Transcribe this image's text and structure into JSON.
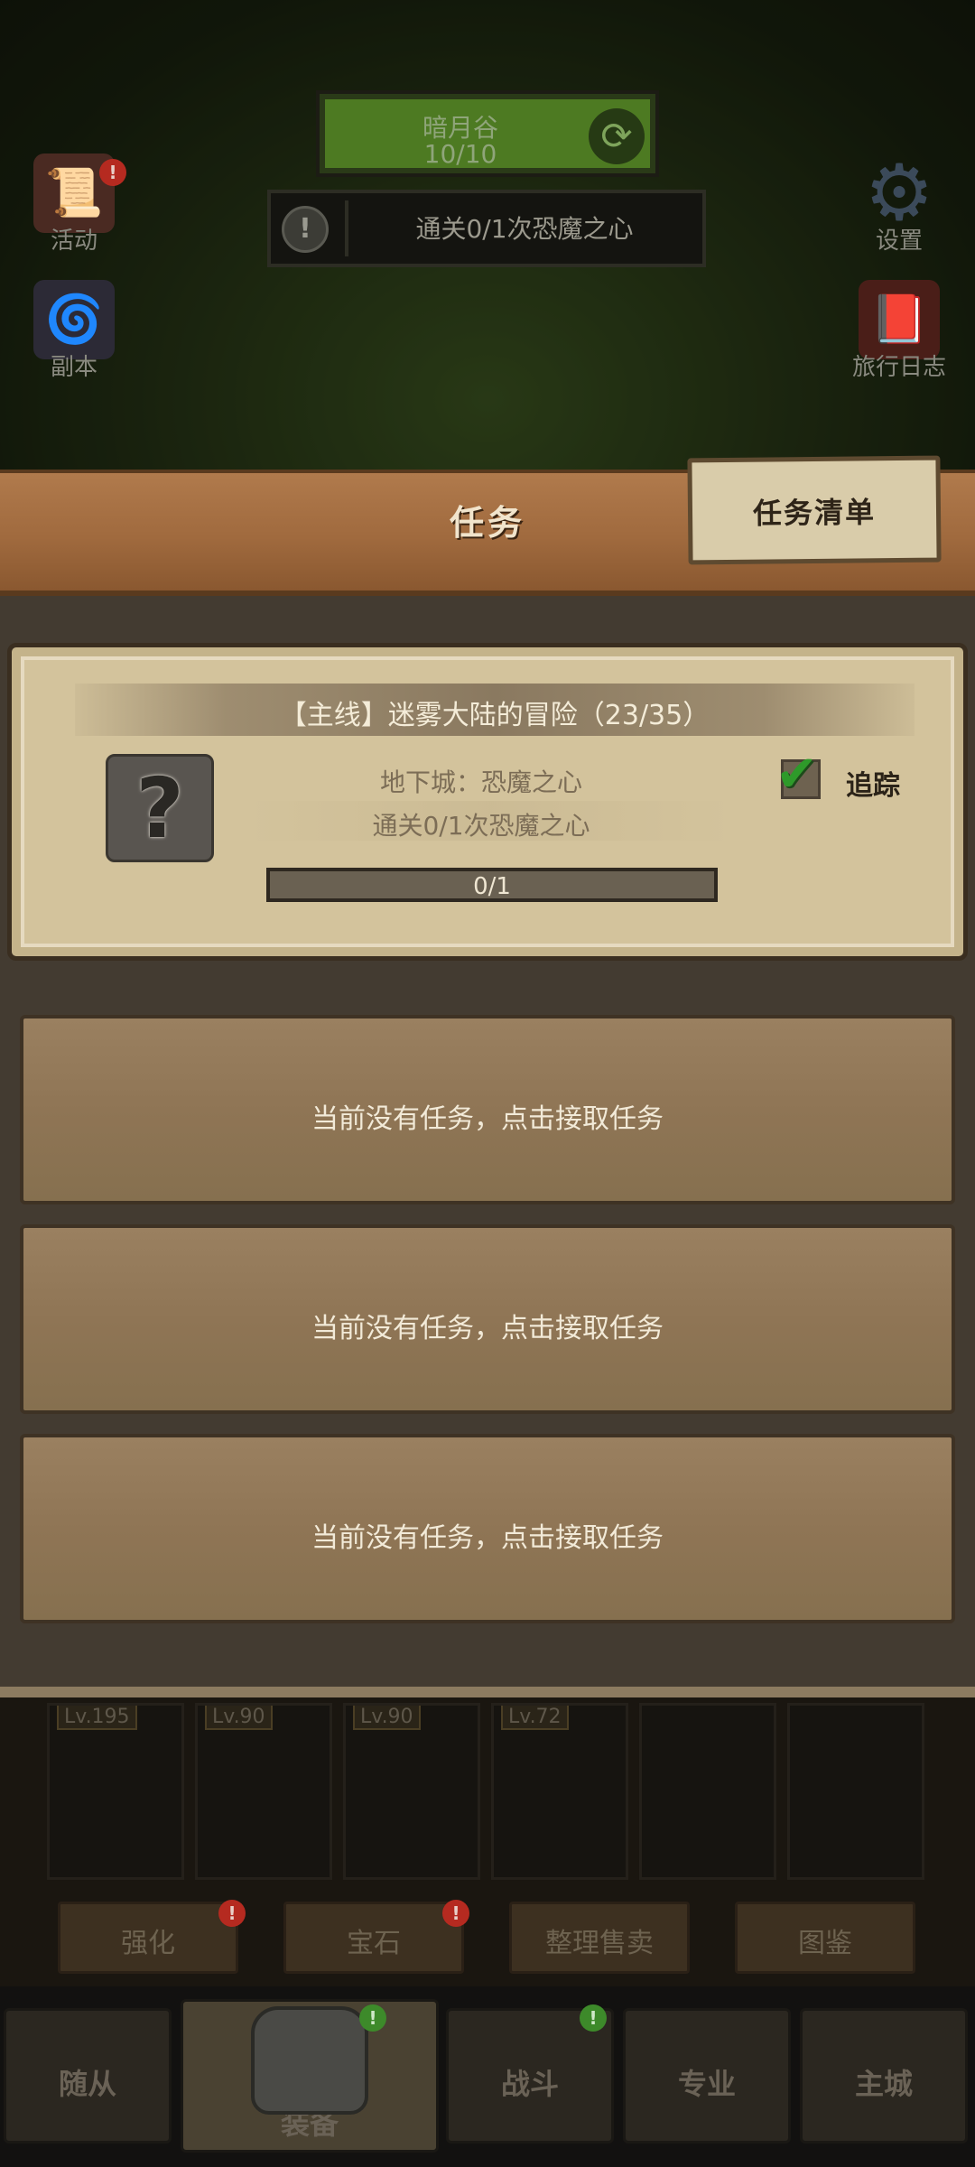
{
  "header": {
    "location_name": "暗月谷",
    "location_count": "10/10",
    "quest_tracker_text": "通关0/1次恐魔之心"
  },
  "side_icons": {
    "activity": "活动",
    "dungeon": "副本",
    "settings": "设置",
    "travel_log": "旅行日志"
  },
  "panel": {
    "title": "任务",
    "list_tab": "任务清单"
  },
  "main_quest": {
    "title": "【主线】迷雾大陆的冒险（23/35）",
    "line1": "地下城：恐魔之心",
    "line2": "通关0/1次恐魔之心",
    "track_label": "追踪",
    "progress_text": "0/1",
    "progress_fraction": 0
  },
  "empty_slots": [
    {
      "text": "当前没有任务，点击接取任务"
    },
    {
      "text": "当前没有任务，点击接取任务"
    },
    {
      "text": "当前没有任务，点击接取任务"
    }
  ],
  "grid_levels": [
    "Lv.195",
    "Lv.90",
    "Lv.90",
    "Lv.72"
  ],
  "sub_buttons": [
    "强化",
    "宝石",
    "整理售卖",
    "图鉴"
  ],
  "nav_tabs": [
    "随从",
    "装备",
    "战斗",
    "专业",
    "主城"
  ],
  "colors": {
    "panel_bg": "#433b31",
    "card_bg": "#d3c39c",
    "header_plank": "#a06a3e",
    "empty_slot": "#8f7555",
    "track_check": "#2e9a2a"
  }
}
